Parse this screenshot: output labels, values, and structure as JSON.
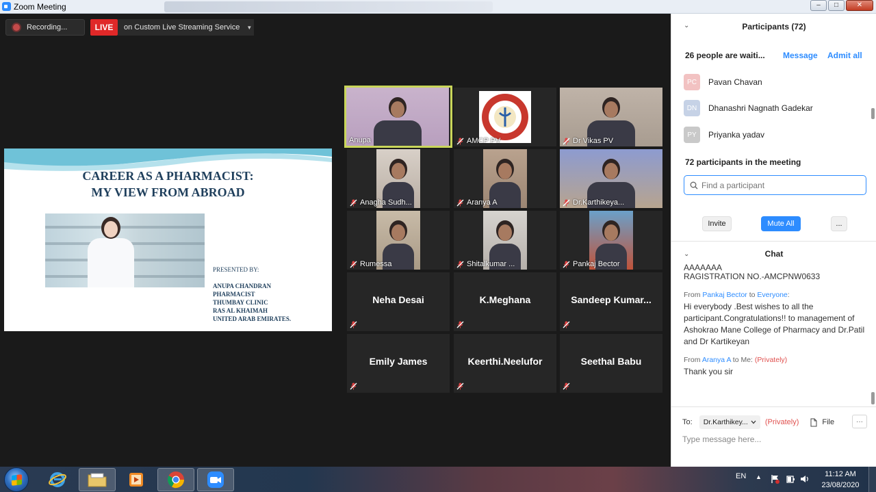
{
  "window": {
    "title": "Zoom Meeting"
  },
  "toolbar": {
    "recording_label": "Recording...",
    "live_label": "LIVE",
    "stream_label": "on Custom Live Streaming Service"
  },
  "slide": {
    "title_line1": "CAREER AS A PHARMACIST:",
    "title_line2": "MY VIEW FROM ABROAD",
    "presented_by": "PRESENTED BY:",
    "credits": [
      "ANUPA CHANDRAN",
      "PHARMACIST",
      "THUMBAY CLINIC",
      "RAS AL KHAIMAH",
      "UNITED ARAB EMIRATES."
    ]
  },
  "tiles": [
    {
      "name": "Anupa",
      "active": true,
      "kind": "video",
      "palette": [
        "#c9b3cc",
        "#b89fbe"
      ]
    },
    {
      "name": "AMCP PV",
      "active": false,
      "kind": "logo",
      "palette": [
        "#2a2a2a",
        "#2a2a2a"
      ]
    },
    {
      "name": "Dr Vikas PV",
      "active": false,
      "kind": "video",
      "palette": [
        "#bfb3a8",
        "#a89c90"
      ]
    },
    {
      "name": "Anagha Sudh...",
      "active": false,
      "kind": "video",
      "palette": [
        "#d8d0c8",
        "#b9aea3"
      ]
    },
    {
      "name": "Aranya A",
      "active": false,
      "kind": "video",
      "palette": [
        "#b9a28e",
        "#9c8673"
      ]
    },
    {
      "name": "Dr.Karthikeya...",
      "active": false,
      "kind": "video",
      "palette": [
        "#8d9bd0",
        "#b7a48f"
      ]
    },
    {
      "name": "Rumessa",
      "active": false,
      "kind": "video",
      "palette": [
        "#c8bba8",
        "#a99a86"
      ]
    },
    {
      "name": "Shitalkumar ...",
      "active": false,
      "kind": "video",
      "palette": [
        "#d6d3cf",
        "#b6b0aa"
      ]
    },
    {
      "name": "Pankaj Bector",
      "active": false,
      "kind": "video",
      "palette": [
        "#6aa0c9",
        "#c0533a"
      ]
    },
    {
      "name": "Neha Desai",
      "active": false,
      "kind": "name"
    },
    {
      "name": "K.Meghana",
      "active": false,
      "kind": "name"
    },
    {
      "name": "Sandeep  Kumar...",
      "active": false,
      "kind": "name"
    },
    {
      "name": "Emily James",
      "active": false,
      "kind": "name"
    },
    {
      "name": "Keerthi.Neelufor",
      "active": false,
      "kind": "name"
    },
    {
      "name": "Seethal Babu",
      "active": false,
      "kind": "name"
    }
  ],
  "participants": {
    "header": "Participants (72)",
    "waiting_text": "26 people are waiti...",
    "message_label": "Message",
    "admit_label": "Admit all",
    "waiting_list": [
      {
        "initials": "PC",
        "name": "Pavan Chavan",
        "color": "#f2c2c2"
      },
      {
        "initials": "DN",
        "name": "Dhanashri Nagnath Gadekar",
        "color": "#c6d2e6"
      },
      {
        "initials": "PY",
        "name": "Priyanka yadav",
        "color": "#c9c9c9"
      }
    ],
    "in_meeting_text": "72 participants in the meeting",
    "search_placeholder": "Find a participant",
    "invite_label": "Invite",
    "mute_all_label": "Mute All",
    "more_label": "..."
  },
  "chat": {
    "header": "Chat",
    "cut_line": "AAAAAAA",
    "line_reg": "RAGISTRATION NO.-AMCPNW0633",
    "msg1_from_prefix": "From ",
    "msg1_sender": "Pankaj Bector",
    "msg1_to_prefix": " to ",
    "msg1_recipient": "Everyone",
    "msg1_suffix": ":",
    "msg1_text": "Hi everybody .Best wishes to all the participant.Congratulations!! to management of Ashokrao Mane College of Pharmacy and Dr.Patil and Dr Kartikeyan",
    "msg2_from_prefix": "From ",
    "msg2_sender": "Aranya A",
    "msg2_to": " to Me: ",
    "msg2_private": "(Privately)",
    "msg2_text": "Thank you sir",
    "to_label": "To:",
    "to_value": "Dr.Karthikey...",
    "private_label": "(Privately)",
    "file_label": "File",
    "dots_label": "···",
    "input_placeholder": "Type message here..."
  },
  "taskbar": {
    "lang": "EN",
    "time": "11:12 AM",
    "date": "23/08/2020"
  }
}
